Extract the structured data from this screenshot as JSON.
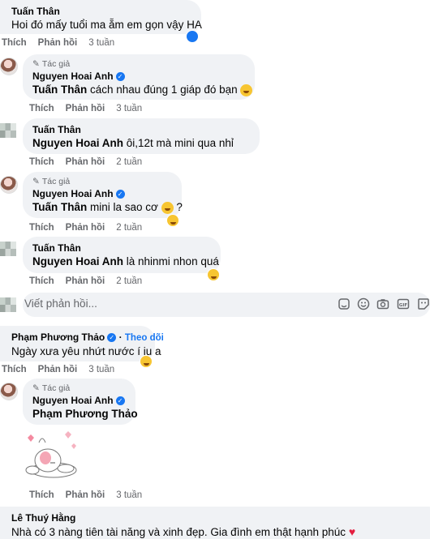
{
  "labels": {
    "like": "Thích",
    "reply": "Phản hồi",
    "author_tag": "Tác giả",
    "follow": "Theo dõi"
  },
  "comments": [
    {
      "name": "Tuấn Thân",
      "text": "Hoi đó mấy tuổi ma ẵm em gọn vậy HA",
      "time": "3 tuần"
    },
    {
      "name": "Nguyen Hoai Anh",
      "tag": "Tuấn Thân",
      "text": " cách nhau đúng 1 giáp đó bạn",
      "time": "3 tuần"
    },
    {
      "name": "Tuấn Thân",
      "tag": "Nguyen Hoai Anh",
      "text": " ôi,12t mà mini qua nhỉ",
      "time": "2 tuần"
    },
    {
      "name": "Nguyen Hoai Anh",
      "tag": "Tuấn Thân",
      "text": " mini la sao cơ",
      "text_after": " ?",
      "time": "2 tuần"
    },
    {
      "name": "Tuấn Thân",
      "tag": "Nguyen Hoai Anh",
      "text": " là nhinmi nhon quá",
      "time": "2 tuần"
    },
    {
      "name": "Phạm Phương Thảo",
      "text": "Ngày xưa yêu nhứt nước í iu a",
      "time": "3 tuần"
    },
    {
      "name": "Nguyen Hoai Anh",
      "tag": "Phạm Phương Thảo",
      "text": "",
      "time": "3 tuần"
    },
    {
      "name": "Lê Thuý Hằng",
      "text": "Nhà có 3 nàng tiên tài năng và xinh đẹp. Gia đình em thật hạnh phúc"
    }
  ],
  "reply_box": {
    "placeholder": "Viết phản hồi..."
  },
  "icons": [
    "pencil-icon",
    "verified-icon",
    "sticker-icon",
    "emoji-icon",
    "camera-icon",
    "gif-icon",
    "sticker-alt-icon"
  ],
  "colors": {
    "bubble": "#f0f2f5",
    "meta": "#65676b",
    "link": "#1877f2",
    "text": "#050505"
  }
}
